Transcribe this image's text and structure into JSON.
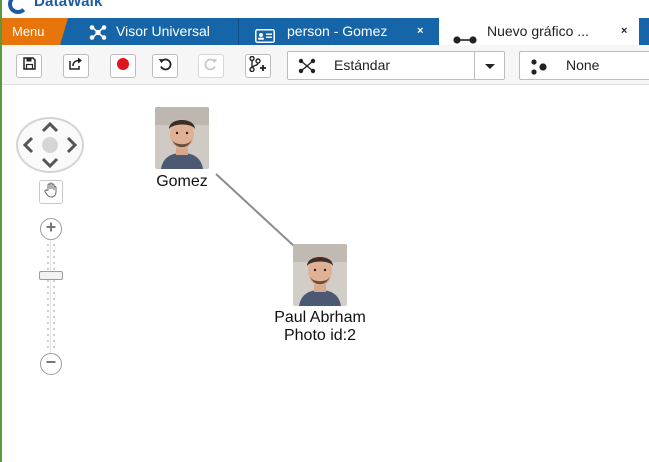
{
  "brand": {
    "name": "DataWalk"
  },
  "tabbar": {
    "menu_label": "Menu",
    "tabs": [
      {
        "label": "Visor Universal",
        "icon": "network-graph-icon",
        "closable": false,
        "active": false
      },
      {
        "label": "person - Gomez",
        "icon": "id-card-icon",
        "closable": true,
        "active": false
      },
      {
        "label": "Nuevo gráfico ...",
        "icon": "graph-link-icon",
        "closable": true,
        "active": true
      }
    ],
    "close_glyph": "×"
  },
  "toolbar": {
    "buttons": [
      {
        "name": "save",
        "icon": "save-icon"
      },
      {
        "name": "export",
        "icon": "export-icon"
      },
      {
        "name": "record",
        "icon": "record-icon"
      },
      {
        "name": "undo",
        "icon": "undo-icon"
      },
      {
        "name": "redo",
        "icon": "redo-icon",
        "disabled": true
      },
      {
        "name": "expand",
        "icon": "branch-add-icon"
      }
    ],
    "layout_select": {
      "value": "Estándar",
      "icon": "layout-icon"
    },
    "group_select": {
      "value": "None",
      "icon": "cluster-icon"
    }
  },
  "graph": {
    "nodes": [
      {
        "id": "gomez",
        "label_lines": [
          "Gomez"
        ]
      },
      {
        "id": "paul",
        "label_lines": [
          "Paul Abrham",
          "Photo id:2"
        ]
      }
    ],
    "edges": [
      {
        "from": "gomez",
        "to": "paul"
      }
    ]
  },
  "colors": {
    "menu_orange": "#e8740c",
    "tab_blue": "#1565a8",
    "record_red": "#e0141e",
    "edge_gray": "#8c8c8c",
    "app_border_green": "#5b9a3c"
  }
}
